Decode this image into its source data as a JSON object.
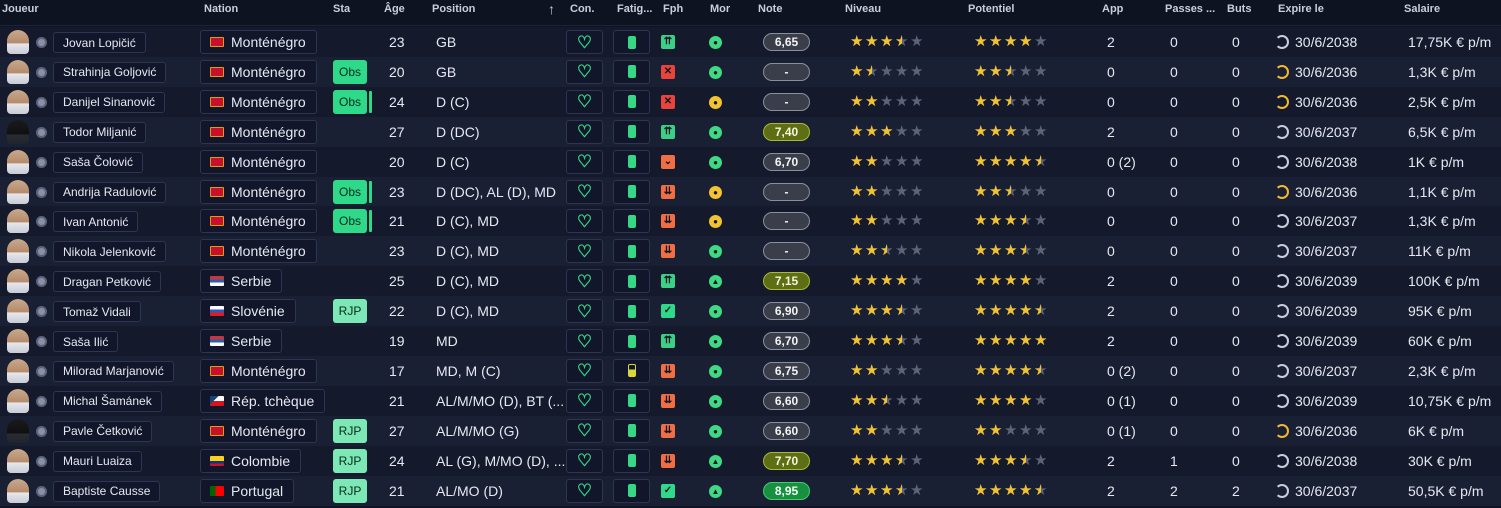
{
  "headers": {
    "joueur": "Joueur",
    "nation": "Nation",
    "sta": "Sta",
    "age": "Âge",
    "position": "Position",
    "sort_arrow": "↑",
    "con": "Con.",
    "fatigue": "Fatig...",
    "fph": "Fph",
    "mor": "Mor",
    "note": "Note",
    "niveau": "Niveau",
    "potentiel": "Potentiel",
    "app": "App",
    "passes": "Passes ...",
    "buts": "Buts",
    "expire": "Expire le",
    "salaire": "Salaire"
  },
  "colors": {
    "mne": "#c8102e",
    "srb": "#2a5fb0",
    "svn": "#2a58c8",
    "cze": "#d7141a",
    "col": "#fcd116",
    "por": "#006600",
    "fph_up": "#3ccf86",
    "fph_down": "#f06e43",
    "fph_x": "#e8443a",
    "fph_check": "#2ed98a",
    "mor_good": "#3fd983",
    "mor_ok": "#f2c230",
    "star": "#f2c230"
  },
  "icons": {
    "heart": "heart-icon",
    "battery": "battery-icon",
    "clock": "clock-icon",
    "avatar": "avatar-icon"
  },
  "players": [
    {
      "name": "Jovan Lopičić",
      "face": "light",
      "flag": "mne",
      "nation": "Monténégro",
      "sta": "",
      "bar": false,
      "age": "23",
      "position": "GB",
      "batt": "full",
      "fph": "up2",
      "fph_sym": "⇈",
      "mor": "good",
      "mor_sym": "●",
      "note": "6,65",
      "note_kind": "grey",
      "niveau": 3.5,
      "potentiel": 4,
      "app": "2",
      "passes": "0",
      "buts": "0",
      "clock": "normal",
      "expire": "30/6/2038",
      "salaire": "17,75K € p/m"
    },
    {
      "name": "Strahinja Goljović",
      "face": "light",
      "flag": "mne",
      "nation": "Monténégro",
      "sta": "Obs",
      "bar": false,
      "age": "20",
      "position": "GB",
      "batt": "full",
      "fph": "x",
      "fph_sym": "✕",
      "mor": "good",
      "mor_sym": "●",
      "note": "-",
      "note_kind": "grey",
      "niveau": 1.5,
      "potentiel": 2.5,
      "app": "0",
      "passes": "0",
      "buts": "0",
      "clock": "warn",
      "expire": "30/6/2036",
      "salaire": "1,3K € p/m"
    },
    {
      "name": "Danijel Sinanović",
      "face": "light",
      "flag": "mne",
      "nation": "Monténégro",
      "sta": "Obs",
      "bar": true,
      "age": "24",
      "position": "D (C)",
      "batt": "full",
      "fph": "x",
      "fph_sym": "✕",
      "mor": "ok",
      "mor_sym": "●",
      "note": "-",
      "note_kind": "grey",
      "niveau": 2,
      "potentiel": 2.5,
      "app": "0",
      "passes": "0",
      "buts": "0",
      "clock": "warn",
      "expire": "30/6/2036",
      "salaire": "2,5K € p/m"
    },
    {
      "name": "Todor Miljanić",
      "face": "dark",
      "flag": "mne",
      "nation": "Monténégro",
      "sta": "",
      "bar": false,
      "age": "27",
      "position": "D (DC)",
      "batt": "full",
      "fph": "up2",
      "fph_sym": "⇈",
      "mor": "good",
      "mor_sym": "●",
      "note": "7,40",
      "note_kind": "olive",
      "niveau": 3,
      "potentiel": 3,
      "app": "2",
      "passes": "0",
      "buts": "0",
      "clock": "normal",
      "expire": "30/6/2037",
      "salaire": "6,5K € p/m"
    },
    {
      "name": "Saša Čolović",
      "face": "light",
      "flag": "mne",
      "nation": "Monténégro",
      "sta": "",
      "bar": false,
      "age": "20",
      "position": "D (C)",
      "batt": "full",
      "fph": "down",
      "fph_sym": "⌄",
      "mor": "good",
      "mor_sym": "●",
      "note": "6,70",
      "note_kind": "grey",
      "niveau": 2,
      "potentiel": 4.5,
      "app": "0 (2)",
      "passes": "0",
      "buts": "0",
      "clock": "normal",
      "expire": "30/6/2038",
      "salaire": "1K € p/m"
    },
    {
      "name": "Andrija Radulović",
      "face": "light",
      "flag": "mne",
      "nation": "Monténégro",
      "sta": "Obs",
      "bar": true,
      "age": "23",
      "position": "D (DC), AL (D), MD",
      "batt": "full",
      "fph": "down2",
      "fph_sym": "⇊",
      "mor": "ok",
      "mor_sym": "●",
      "note": "-",
      "note_kind": "grey",
      "niveau": 2,
      "potentiel": 2.5,
      "app": "0",
      "passes": "0",
      "buts": "0",
      "clock": "warn",
      "expire": "30/6/2036",
      "salaire": "1,1K € p/m"
    },
    {
      "name": "Ivan Antonić",
      "face": "light",
      "flag": "mne",
      "nation": "Monténégro",
      "sta": "Obs",
      "bar": true,
      "age": "21",
      "position": "D (C), MD",
      "batt": "full",
      "fph": "down2",
      "fph_sym": "⇊",
      "mor": "ok",
      "mor_sym": "●",
      "note": "-",
      "note_kind": "grey",
      "niveau": 2,
      "potentiel": 3.5,
      "app": "0",
      "passes": "0",
      "buts": "0",
      "clock": "normal",
      "expire": "30/6/2037",
      "salaire": "1,3K € p/m"
    },
    {
      "name": "Nikola Jelenković",
      "face": "light",
      "flag": "mne",
      "nation": "Monténégro",
      "sta": "",
      "bar": false,
      "age": "23",
      "position": "D (C), MD",
      "batt": "full",
      "fph": "down2",
      "fph_sym": "⇊",
      "mor": "good",
      "mor_sym": "●",
      "note": "-",
      "note_kind": "grey",
      "niveau": 2.5,
      "potentiel": 3.5,
      "app": "0",
      "passes": "0",
      "buts": "0",
      "clock": "normal",
      "expire": "30/6/2037",
      "salaire": "11K € p/m"
    },
    {
      "name": "Dragan Petković",
      "face": "light",
      "flag": "srb",
      "nation": "Serbie",
      "sta": "",
      "bar": false,
      "age": "25",
      "position": "D (C), MD",
      "batt": "full",
      "fph": "up2",
      "fph_sym": "⇈",
      "mor": "good",
      "mor_sym": "▲",
      "note": "7,15",
      "note_kind": "olive",
      "niveau": 4,
      "potentiel": 4,
      "app": "2",
      "passes": "0",
      "buts": "0",
      "clock": "normal",
      "expire": "30/6/2039",
      "salaire": "100K € p/m"
    },
    {
      "name": "Tomaž Vidali",
      "face": "light",
      "flag": "svn",
      "nation": "Slovénie",
      "sta": "RJP",
      "bar": false,
      "age": "22",
      "position": "D (C), MD",
      "batt": "full",
      "fph": "check",
      "fph_sym": "✓",
      "mor": "good",
      "mor_sym": "●",
      "note": "6,90",
      "note_kind": "grey",
      "niveau": 3.5,
      "potentiel": 4.5,
      "app": "2",
      "passes": "0",
      "buts": "0",
      "clock": "normal",
      "expire": "30/6/2039",
      "salaire": "95K € p/m"
    },
    {
      "name": "Saša Ilić",
      "face": "light",
      "flag": "srb",
      "nation": "Serbie",
      "sta": "",
      "bar": false,
      "age": "19",
      "position": "MD",
      "batt": "full",
      "fph": "up2",
      "fph_sym": "⇈",
      "mor": "good",
      "mor_sym": "●",
      "note": "6,70",
      "note_kind": "grey",
      "niveau": 3.5,
      "potentiel": 5,
      "app": "2",
      "passes": "0",
      "buts": "0",
      "clock": "normal",
      "expire": "30/6/2039",
      "salaire": "60K € p/m"
    },
    {
      "name": "Milorad Marjanović",
      "face": "light",
      "flag": "mne",
      "nation": "Monténégro",
      "sta": "",
      "bar": false,
      "age": "17",
      "position": "MD, M (C)",
      "batt": "half",
      "fph": "down2",
      "fph_sym": "⇊",
      "mor": "good",
      "mor_sym": "●",
      "note": "6,75",
      "note_kind": "grey",
      "niveau": 2,
      "potentiel": 4.5,
      "app": "0 (2)",
      "passes": "0",
      "buts": "0",
      "clock": "normal",
      "expire": "30/6/2037",
      "salaire": "2,3K € p/m"
    },
    {
      "name": "Michal Šamánek",
      "face": "light",
      "flag": "cze",
      "nation": "Rép. tchèque",
      "sta": "",
      "bar": false,
      "age": "21",
      "position": "AL/M/MO (D), BT (...",
      "batt": "full",
      "fph": "down2",
      "fph_sym": "⇊",
      "mor": "good",
      "mor_sym": "●",
      "note": "6,60",
      "note_kind": "grey",
      "niveau": 2.5,
      "potentiel": 4,
      "app": "0 (1)",
      "passes": "0",
      "buts": "0",
      "clock": "normal",
      "expire": "30/6/2039",
      "salaire": "10,75K € p/m"
    },
    {
      "name": "Pavle Četković",
      "face": "dark",
      "flag": "mne",
      "nation": "Monténégro",
      "sta": "RJP",
      "bar": false,
      "age": "27",
      "position": "AL/M/MO (G)",
      "batt": "full",
      "fph": "down2",
      "fph_sym": "⇊",
      "mor": "good",
      "mor_sym": "●",
      "note": "6,60",
      "note_kind": "grey",
      "niveau": 2,
      "potentiel": 2,
      "app": "0 (1)",
      "passes": "0",
      "buts": "0",
      "clock": "warn",
      "expire": "30/6/2036",
      "salaire": "6K € p/m"
    },
    {
      "name": "Mauri Luaiza",
      "face": "light",
      "flag": "col",
      "nation": "Colombie",
      "sta": "RJP",
      "bar": false,
      "age": "24",
      "position": "AL (G), M/MO (D), ...",
      "batt": "full",
      "fph": "down2",
      "fph_sym": "⇊",
      "mor": "good",
      "mor_sym": "▲",
      "note": "7,70",
      "note_kind": "olive",
      "niveau": 3.5,
      "potentiel": 3.5,
      "app": "2",
      "passes": "1",
      "buts": "0",
      "clock": "normal",
      "expire": "30/6/2038",
      "salaire": "30K € p/m"
    },
    {
      "name": "Baptiste Causse",
      "face": "light",
      "flag": "por",
      "nation": "Portugal",
      "sta": "RJP",
      "bar": false,
      "age": "21",
      "position": "AL/MO (D)",
      "batt": "full",
      "fph": "check",
      "fph_sym": "✓",
      "mor": "good",
      "mor_sym": "▲",
      "note": "8,95",
      "note_kind": "green",
      "niveau": 3.5,
      "potentiel": 4.5,
      "app": "2",
      "passes": "2",
      "buts": "2",
      "clock": "normal",
      "expire": "30/6/2037",
      "salaire": "50,5K € p/m"
    }
  ]
}
